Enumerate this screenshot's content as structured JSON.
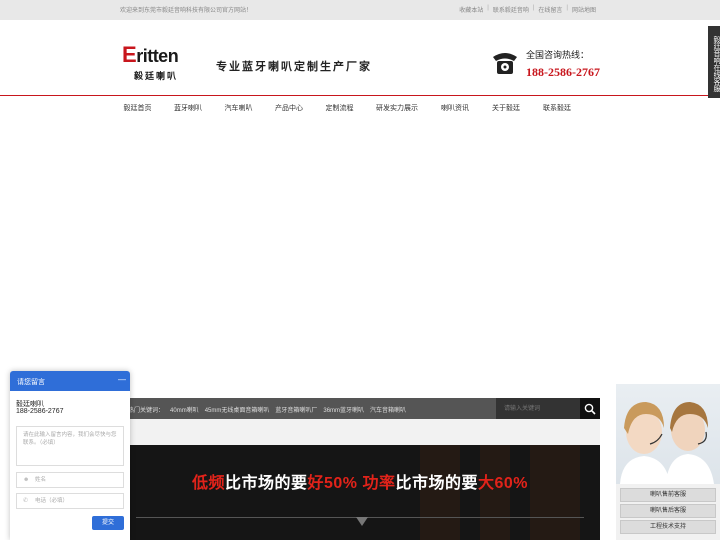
{
  "topbar": {
    "welcome": "欢迎来到东莞市毅廷音响科技有限公司官方网站！",
    "links": [
      "收藏本站",
      "联系毅廷音响",
      "在线留言",
      "网站地图"
    ]
  },
  "header": {
    "logo_en_initial": "E",
    "logo_en_rest": "ritten",
    "logo_cn": "毅廷喇叭",
    "slogan": "专业蓝牙喇叭定制生产厂家",
    "hotline_label": "全国咨询热线：",
    "hotline_number": "188-2586-2767",
    "phone_icon": "telephone-icon"
  },
  "nav": {
    "items": [
      "毅廷首页",
      "蓝牙喇叭",
      "汽车喇叭",
      "产品中心",
      "定制流程",
      "研发实力展示",
      "喇叭资讯",
      "关于毅廷",
      "联系毅廷"
    ]
  },
  "search": {
    "hotwords_label": "热门关键词：",
    "hotwords": [
      "40mm喇叭",
      "45mm无线桌面音箱喇叭",
      "蓝牙音箱喇叭厂",
      "36mm蓝牙喇叭",
      "汽车音箱喇叭"
    ],
    "placeholder": "请输入关键词",
    "icon": "search-icon"
  },
  "promo": {
    "part1_red": "低频",
    "part2": "比市场的要",
    "part3_red": "好50%",
    "part4_red": "功率",
    "part5": "比市场的要",
    "part6_red": "大60%"
  },
  "vertical_tab": "毅廷音响在线客服",
  "service": {
    "buttons": [
      "喇叭售前客服",
      "喇叭售后客服",
      "工程技术支持"
    ]
  },
  "chat": {
    "title": "请您留言",
    "minimize": "—",
    "company": "毅廷喇叭",
    "phone": "188-2586-2767",
    "message_placeholder": "请在此输入留言内容，我们会尽快与您联系。（必填）",
    "name_placeholder": "姓名",
    "tel_placeholder": "电话（必填）",
    "submit": "提交"
  },
  "colors": {
    "brand_red": "#c8161d",
    "chat_blue": "#2f6ed8"
  }
}
